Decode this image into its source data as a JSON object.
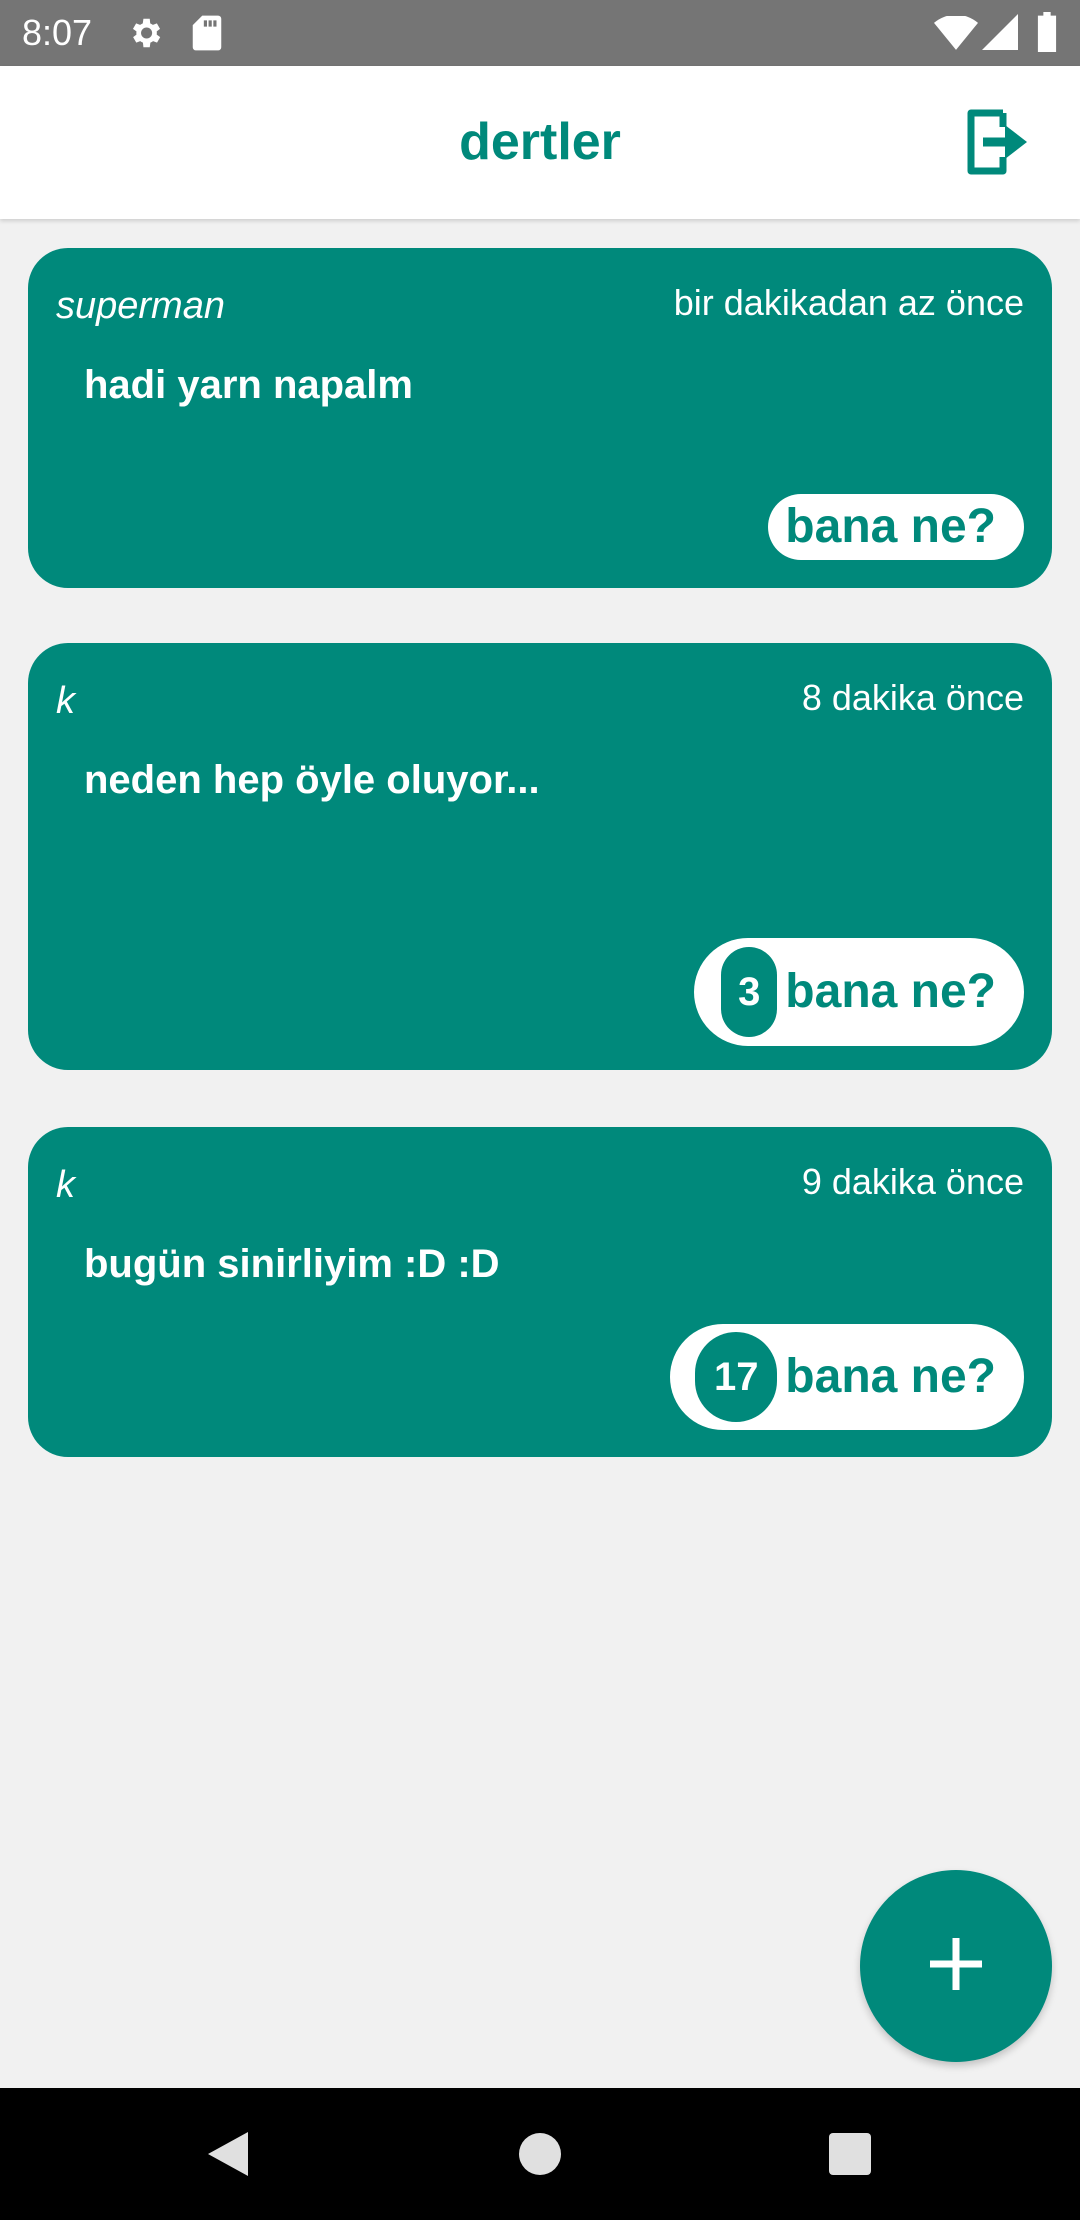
{
  "status_bar": {
    "time": "8:07"
  },
  "app_bar": {
    "title": "dertler"
  },
  "posts": [
    {
      "author": "superman",
      "time": "bir dakikadan az önce",
      "text": "hadi yarn napalm",
      "button_label": "bana ne?",
      "count": null
    },
    {
      "author": "k",
      "time": "8 dakika önce",
      "text": "neden hep öyle oluyor...",
      "button_label": "bana ne?",
      "count": "3"
    },
    {
      "author": "k",
      "time": "9 dakika önce",
      "text": "bugün sinirliyim :D :D",
      "button_label": "bana ne?",
      "count": "17"
    }
  ],
  "colors": {
    "accent": "#00897b",
    "background": "#f1f1f1",
    "status_bar": "#757575"
  },
  "icons": {
    "status": [
      "gear-icon",
      "sd-card-icon",
      "wifi-icon",
      "signal-icon",
      "battery-icon"
    ],
    "app_bar": "logout-icon",
    "fab": "plus-icon",
    "nav": [
      "back-icon",
      "home-icon",
      "recents-icon"
    ]
  }
}
